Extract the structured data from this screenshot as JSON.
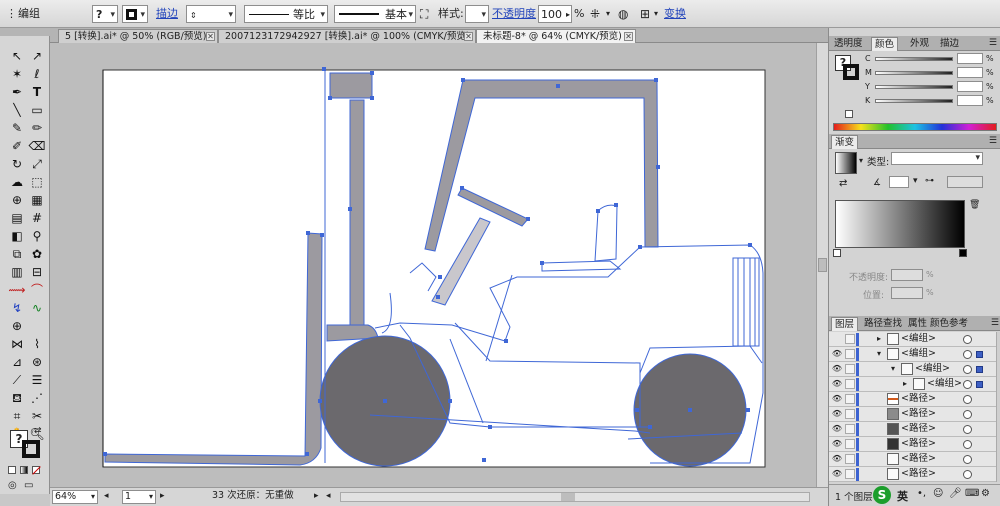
{
  "controlbar": {
    "object_type": "编组",
    "fill_value": "?",
    "stroke_label": "描边",
    "stroke_weight": "",
    "profile_label": "等比",
    "brush_label": "基本",
    "style_label": "样式:",
    "opacity_label": "不透明度",
    "opacity_value": "100",
    "opacity_unit": "%",
    "transform_label": "变换"
  },
  "tabs": [
    {
      "label": "5 [转换].ai* @ 50% (RGB/预览)"
    },
    {
      "label": "2007123172942927 [转换].ai* @ 100% (CMYK/预览)"
    },
    {
      "label": "未标题-8* @ 64% (CMYK/预览)"
    }
  ],
  "statusbar": {
    "zoom": "64%",
    "page": "1",
    "undo_text": "33 次还原：无重做"
  },
  "panels": {
    "color_tabs": [
      "透明度",
      "颜色",
      "外观",
      "描边"
    ],
    "color_fill": "?",
    "channels": [
      "C",
      "M",
      "Y",
      "K"
    ],
    "gradient_tab": "渐变",
    "gradient_type_label": "类型:",
    "opacity_label": "不透明度:",
    "opacity_unit": "%",
    "location_label": "位置:",
    "location_unit": "%",
    "layers_tabs": [
      "图层",
      "路径查找",
      "属性",
      "颜色参考"
    ],
    "layers": [
      {
        "name": "<编组>",
        "indent": 0
      },
      {
        "name": "<编组>",
        "indent": 0
      },
      {
        "name": "<编组>",
        "indent": 1
      },
      {
        "name": "<编组>",
        "indent": 2
      },
      {
        "name": "<路径>",
        "indent": 0
      },
      {
        "name": "<路径>",
        "indent": 0
      },
      {
        "name": "<路径>",
        "indent": 0
      },
      {
        "name": "<路径>",
        "indent": 0
      },
      {
        "name": "<路径>",
        "indent": 0
      },
      {
        "name": "<路径>",
        "indent": 0
      }
    ],
    "layers_count": "1 个图层"
  },
  "ime": {
    "logo": "S",
    "lang": "英"
  },
  "colors": {
    "selection_blue": "#3f67d6",
    "shape_gray": "#9c9aa0",
    "wheel_gray": "#6b696d"
  }
}
